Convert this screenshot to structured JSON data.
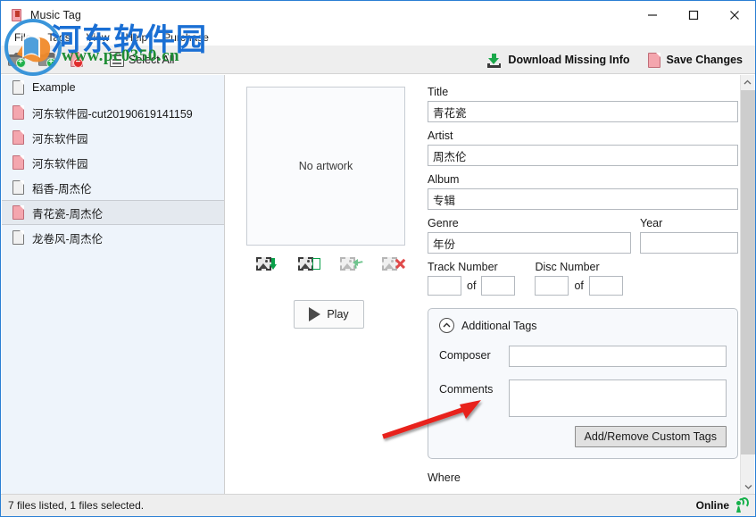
{
  "window": {
    "title": "Music Tag",
    "icon": "music-file-icon",
    "controls": {
      "minimize": "–",
      "maximize": "□",
      "close": "✕"
    }
  },
  "menubar": {
    "items": [
      {
        "label": "File",
        "name": "menu-file"
      },
      {
        "label": "Tags",
        "name": "menu-tags"
      },
      {
        "label": "View",
        "name": "menu-view"
      },
      {
        "label": "Help",
        "name": "menu-help"
      },
      {
        "label": "Purchase",
        "name": "menu-purchase"
      }
    ]
  },
  "toolbar": {
    "add_folder_icon": "add-folder-icon",
    "add_file_icon": "add-file-icon",
    "remove_file_icon": "remove-file-icon",
    "select_all_label": "Select All",
    "select_all_icon": "list-icon",
    "download_missing_label": "Download Missing Info",
    "download_missing_icon": "download-icon",
    "save_changes_label": "Save Changes",
    "save_changes_icon": "save-file-icon"
  },
  "filelist": {
    "items": [
      {
        "label": "Example",
        "icon_color": "white",
        "selected": false
      },
      {
        "label": "河东软件园-cut20190619141159",
        "icon_color": "pink",
        "selected": false
      },
      {
        "label": "河东软件园",
        "icon_color": "pink",
        "selected": false
      },
      {
        "label": "河东软件园",
        "icon_color": "pink",
        "selected": false
      },
      {
        "label": "稻香-周杰伦",
        "icon_color": "white",
        "selected": false
      },
      {
        "label": "青花瓷-周杰伦",
        "icon_color": "pink",
        "selected": true
      },
      {
        "label": "龙卷风-周杰伦",
        "icon_color": "white",
        "selected": false
      }
    ]
  },
  "artwork": {
    "placeholder": "No artwork",
    "actions": [
      {
        "name": "download-artwork-icon",
        "title": "Download artwork"
      },
      {
        "name": "paste-artwork-icon",
        "title": "Paste artwork from file"
      },
      {
        "name": "revert-artwork-icon",
        "title": "Revert artwork"
      },
      {
        "name": "delete-artwork-icon",
        "title": "Delete artwork"
      }
    ],
    "play_label": "Play",
    "play_icon": "play-triangle-icon"
  },
  "form": {
    "title": {
      "label": "Title",
      "value": "青花瓷",
      "placeholder": ""
    },
    "artist": {
      "label": "Artist",
      "value": "周杰伦",
      "placeholder": ""
    },
    "album": {
      "label": "Album",
      "value": "专辑",
      "placeholder": ""
    },
    "genre": {
      "label": "Genre",
      "value": "年份",
      "placeholder": ""
    },
    "year": {
      "label": "Year",
      "value": "",
      "placeholder": ""
    },
    "track_number": {
      "label": "Track Number",
      "value": "",
      "of_label": "of",
      "total": ""
    },
    "disc_number": {
      "label": "Disc Number",
      "value": "",
      "of_label": "of",
      "total": ""
    },
    "where_label": "Where"
  },
  "additional_tags": {
    "header": "Additional Tags",
    "collapse_icon": "chevron-up-icon",
    "composer": {
      "label": "Composer",
      "value": "",
      "placeholder": ""
    },
    "comments": {
      "label": "Comments",
      "value": "",
      "placeholder": ""
    },
    "custom_tags_button": "Add/Remove Custom Tags"
  },
  "scrollbar": {
    "up_icon": "chevron-up-icon",
    "down_icon": "chevron-down-icon"
  },
  "statusbar": {
    "files_text": "7 files listed, 1 files selected.",
    "connection": "Online",
    "connection_icon": "signal-icon"
  },
  "watermark": {
    "site_name": "河东软件园",
    "url": "www.pc0350.cn",
    "logo_icon": "site-logo-icon"
  },
  "annotation": {
    "arrow_icon": "red-arrow-annotation",
    "color": "#e8221d"
  },
  "colors": {
    "accent": "#2a7fd4",
    "toolbar_bg": "#eeeeee",
    "list_bg": "#eef4fb",
    "selection": "#e4e9ef",
    "green": "#15b04a",
    "pink_doc": "#f4a6ae"
  }
}
